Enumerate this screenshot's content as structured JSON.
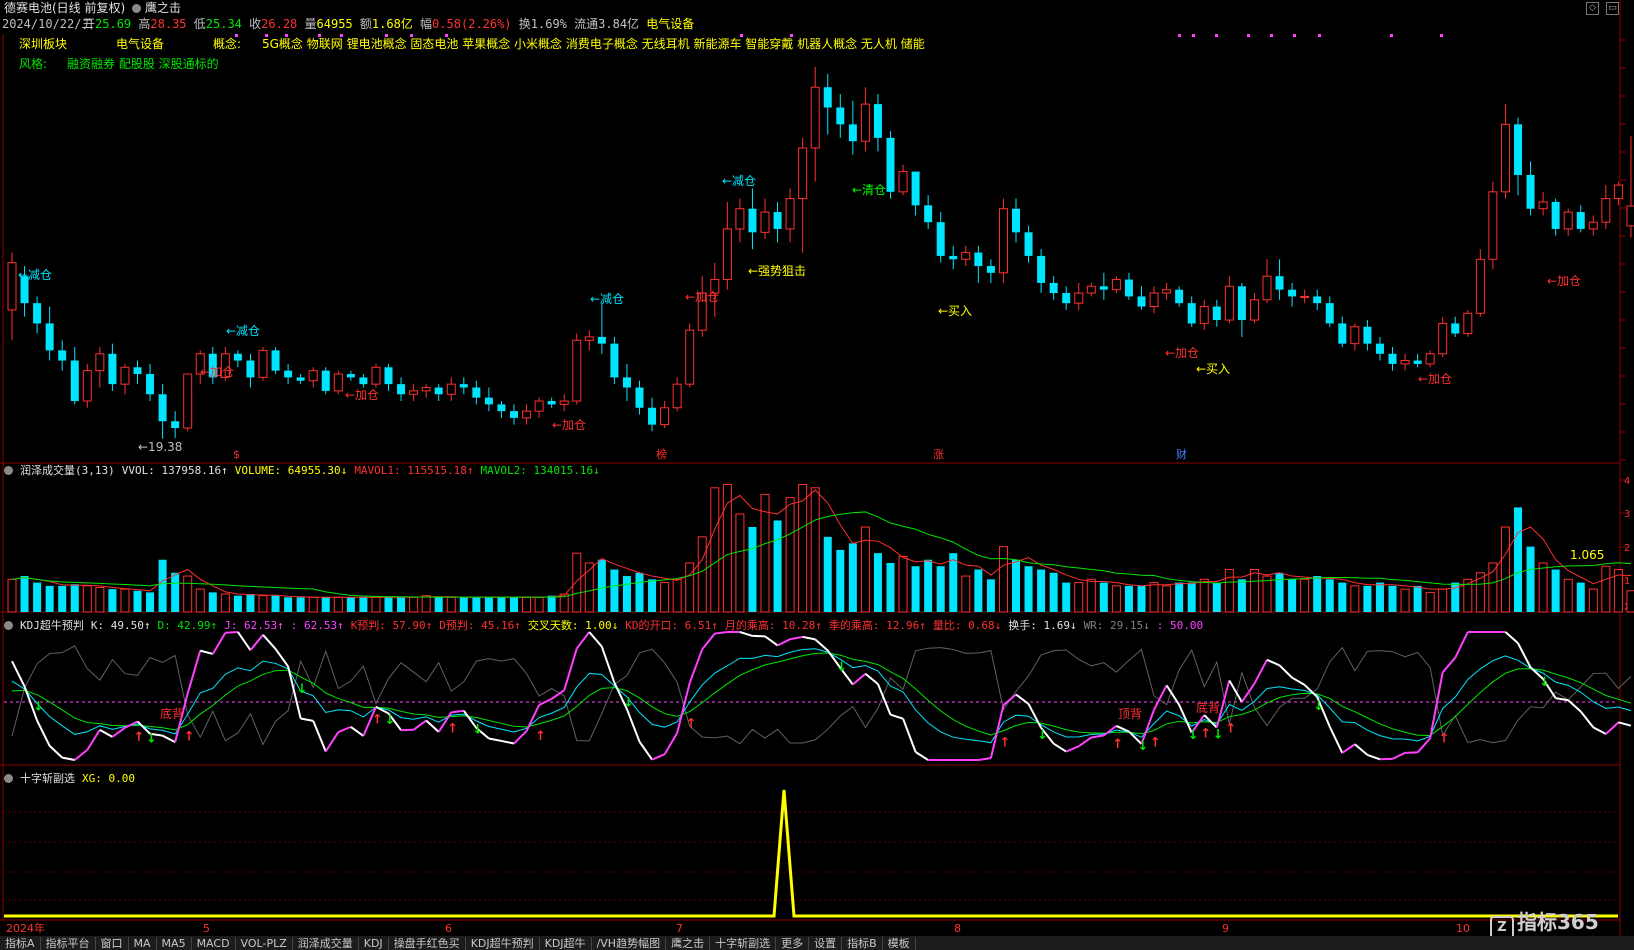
{
  "header": {
    "stock_name": "德赛电池(日线 前复权)",
    "indicator": "鹰之击",
    "date": "2024/10/22/二",
    "open_label": "开",
    "open": "25.69",
    "high_label": "高",
    "high": "28.35",
    "low_label": "低",
    "low": "25.34",
    "close_label": "收",
    "close": "26.28",
    "vol_label": "量",
    "vol": "64955",
    "amount_label": "额",
    "amount": "1.68亿",
    "change_label": "幅",
    "change": "0.58(2.26%)",
    "turnover_label": "换",
    "turnover": "1.69%",
    "float_label": "流通",
    "float": "3.84亿",
    "sector": "电气设备"
  },
  "info": {
    "board": "深圳板块",
    "industry": "电气设备",
    "concept_label": "概念:",
    "concepts": "5G概念 物联网 锂电池概念 固态电池 苹果概念 小米概念 消费电子概念 无线耳机 新能源车 智能穿戴 机器人概念 无人机 储能",
    "style_label": "风格:",
    "styles": "融资融券 配股股 深股通标的"
  },
  "annotations": [
    {
      "text": "←减仓",
      "color": "#00e5ff"
    },
    {
      "text": "←19.38",
      "color": "#c0c0c0"
    },
    {
      "text": "←减仓",
      "color": "#00e5ff"
    },
    {
      "text": "←加仓",
      "color": "#ff3030"
    },
    {
      "text": "←加仓",
      "color": "#ff3030"
    },
    {
      "text": "←加仓",
      "color": "#ff3030"
    },
    {
      "text": "←减仓",
      "color": "#00e5ff"
    },
    {
      "text": "←加仓",
      "color": "#ff3030"
    },
    {
      "text": "←减仓",
      "color": "#00e5ff"
    },
    {
      "text": "←强势狙击",
      "color": "#ffff00"
    },
    {
      "text": "←清仓",
      "color": "#00ff00"
    },
    {
      "text": "←买入",
      "color": "#ffff00"
    },
    {
      "text": "←加仓",
      "color": "#ff3030"
    },
    {
      "text": "←买入",
      "color": "#ffff00"
    },
    {
      "text": "←加仓",
      "color": "#ff3030"
    },
    {
      "text": "←加仓",
      "color": "#ff3030"
    }
  ],
  "markers": [
    {
      "text": "$",
      "color": "#ff3030"
    },
    {
      "text": "榜",
      "color": "#ff3030"
    },
    {
      "text": "涨",
      "color": "#ff3030"
    },
    {
      "text": "财",
      "color": "#4080ff"
    }
  ],
  "volume_panel": {
    "title": "润泽成交量(3,13)",
    "vvol": "VVOL: 137958.16↑",
    "volume": "VOLUME: 64955.30↓",
    "mavol1": "MAVOL1: 115515.18↑",
    "mavol2": "MAVOL2: 134015.16↓",
    "right_value": "1.065",
    "axis_labels": [
      "4",
      "3",
      "2",
      "1",
      "X1"
    ]
  },
  "kdj_panel": {
    "title": "KDJ超牛预判",
    "k": "K: 49.50↑",
    "d": "D: 42.99↑",
    "j": "J: 62.53↑",
    "j2": ": 62.53↑",
    "k_pred": "K预判: 57.90↑",
    "d_pred": "D预判: 45.16↑",
    "cross_days": "交叉天数: 1.00↓",
    "kd_gap": "KD的开口: 6.51↑",
    "month_mult": "月的乘高: 10.28↑",
    "season_mult": "季的乘高: 12.96↑",
    "vol_ratio": "量比: 0.68↓",
    "turnover": "换手: 1.69↓",
    "wr": "WR: 29.15↓",
    "val50": ": 50.00",
    "label_divergence": "底背",
    "label_divergence2": "顶背"
  },
  "xg_panel": {
    "title": "十字斩副选",
    "xg": "XG: 0.00"
  },
  "time_axis": [
    "2024年",
    "5",
    "6",
    "7",
    "8",
    "9",
    "10"
  ],
  "bottom_tabs": [
    "指标A",
    "指标平台",
    "窗口",
    "MA",
    "MA5",
    "MACD",
    "VOL-PLZ",
    "润泽成交量",
    "KDJ",
    "操盘手红色买",
    "KDJ超牛预判",
    "KDJ超牛",
    "/VH趋势幅图",
    "鹰之击",
    "十字斩副选",
    "更多",
    "设置",
    "指标B",
    "模板"
  ],
  "logo_text": "指标365",
  "chart_data": {
    "type": "candlestick",
    "candles": [
      [
        23.2,
        24.6,
        22.3,
        24.9
      ],
      [
        24.2,
        23.4,
        23.0,
        24.5
      ],
      [
        23.4,
        22.8,
        22.5,
        23.6
      ],
      [
        22.8,
        22.0,
        21.7,
        23.3
      ],
      [
        22.0,
        21.7,
        21.4,
        22.3
      ],
      [
        21.7,
        20.5,
        20.4,
        22.1
      ],
      [
        20.5,
        21.4,
        20.3,
        21.6
      ],
      [
        21.4,
        21.9,
        20.9,
        22.1
      ],
      [
        21.9,
        21.0,
        20.8,
        22.2
      ],
      [
        21.0,
        21.5,
        20.7,
        21.6
      ],
      [
        21.5,
        21.3,
        21.0,
        21.7
      ],
      [
        21.3,
        20.7,
        20.5,
        21.6
      ],
      [
        20.7,
        19.9,
        19.38,
        21.0
      ],
      [
        19.9,
        19.7,
        19.4,
        20.2
      ],
      [
        19.7,
        21.3,
        19.6,
        21.3
      ],
      [
        21.3,
        21.9,
        21.0,
        22.0
      ],
      [
        21.9,
        21.2,
        21.0,
        22.1
      ],
      [
        21.2,
        21.9,
        21.1,
        22.1
      ],
      [
        21.9,
        21.7,
        21.5,
        22.0
      ],
      [
        21.7,
        21.2,
        20.9,
        21.9
      ],
      [
        21.2,
        22.0,
        21.1,
        22.1
      ],
      [
        22.0,
        21.4,
        21.3,
        22.1
      ],
      [
        21.4,
        21.2,
        21.0,
        21.6
      ],
      [
        21.2,
        21.1,
        21.0,
        21.3
      ],
      [
        21.1,
        21.4,
        20.9,
        21.5
      ],
      [
        21.4,
        20.8,
        20.7,
        21.5
      ],
      [
        20.8,
        21.3,
        20.7,
        21.4
      ],
      [
        21.3,
        21.2,
        21.1,
        21.4
      ],
      [
        21.2,
        21.0,
        20.9,
        21.3
      ],
      [
        21.0,
        21.5,
        20.9,
        21.6
      ],
      [
        21.5,
        21.0,
        20.8,
        21.6
      ],
      [
        21.0,
        20.7,
        20.5,
        21.2
      ],
      [
        20.7,
        20.8,
        20.5,
        21.0
      ],
      [
        20.8,
        20.9,
        20.6,
        21.0
      ],
      [
        20.9,
        20.7,
        20.5,
        21.0
      ],
      [
        20.7,
        21.0,
        20.5,
        21.2
      ],
      [
        21.0,
        20.9,
        20.7,
        21.2
      ],
      [
        20.9,
        20.6,
        20.4,
        21.1
      ],
      [
        20.6,
        20.4,
        20.2,
        20.9
      ],
      [
        20.4,
        20.2,
        20.0,
        20.5
      ],
      [
        20.2,
        20.0,
        19.8,
        20.4
      ],
      [
        20.0,
        20.2,
        19.8,
        20.4
      ],
      [
        20.2,
        20.5,
        20.0,
        20.6
      ],
      [
        20.5,
        20.4,
        20.3,
        20.6
      ],
      [
        20.4,
        20.5,
        20.2,
        20.7
      ],
      [
        20.5,
        22.3,
        20.4,
        22.5
      ],
      [
        22.3,
        22.4,
        22.0,
        22.6
      ],
      [
        22.4,
        22.2,
        21.9,
        23.4
      ],
      [
        22.2,
        21.2,
        21.0,
        22.4
      ],
      [
        21.2,
        20.9,
        20.5,
        21.6
      ],
      [
        20.9,
        20.3,
        20.1,
        21.1
      ],
      [
        20.3,
        19.8,
        19.6,
        20.6
      ],
      [
        19.8,
        20.3,
        19.7,
        20.5
      ],
      [
        20.3,
        21.0,
        20.2,
        21.2
      ],
      [
        21.0,
        22.6,
        20.9,
        22.8
      ],
      [
        22.6,
        23.7,
        22.4,
        24.2
      ],
      [
        23.7,
        24.1,
        23.0,
        24.6
      ],
      [
        24.1,
        25.6,
        23.8,
        26.4
      ],
      [
        25.6,
        26.2,
        25.2,
        26.5
      ],
      [
        26.2,
        25.5,
        25.0,
        26.8
      ],
      [
        25.5,
        26.1,
        25.3,
        26.5
      ],
      [
        26.1,
        25.6,
        25.2,
        26.4
      ],
      [
        25.6,
        26.5,
        25.2,
        26.8
      ],
      [
        26.5,
        28.0,
        24.9,
        28.3
      ],
      [
        28.0,
        29.8,
        27.0,
        30.4
      ],
      [
        29.8,
        29.2,
        28.4,
        30.2
      ],
      [
        29.2,
        28.7,
        28.3,
        29.6
      ],
      [
        28.7,
        28.2,
        27.8,
        29.4
      ],
      [
        28.2,
        29.3,
        27.9,
        29.8
      ],
      [
        29.3,
        28.3,
        27.9,
        29.6
      ],
      [
        28.3,
        26.7,
        26.5,
        28.5
      ],
      [
        26.7,
        27.3,
        26.6,
        27.5
      ],
      [
        27.3,
        26.3,
        26.0,
        27.3
      ],
      [
        26.3,
        25.8,
        25.6,
        26.6
      ],
      [
        25.8,
        24.8,
        24.6,
        26.1
      ],
      [
        24.8,
        24.7,
        24.4,
        25.1
      ],
      [
        24.7,
        24.9,
        24.5,
        25.1
      ],
      [
        24.9,
        24.5,
        24.0,
        25.1
      ],
      [
        24.5,
        24.3,
        24.0,
        24.7
      ],
      [
        24.3,
        26.2,
        24.0,
        26.5
      ],
      [
        26.2,
        25.5,
        25.2,
        26.5
      ],
      [
        25.5,
        24.8,
        24.6,
        25.7
      ],
      [
        24.8,
        24.0,
        23.7,
        25.0
      ],
      [
        24.0,
        23.7,
        23.5,
        24.2
      ],
      [
        23.7,
        23.4,
        23.2,
        23.9
      ],
      [
        23.4,
        23.7,
        23.2,
        24.0
      ],
      [
        23.7,
        23.9,
        23.6,
        24.0
      ],
      [
        23.9,
        23.8,
        23.5,
        24.3
      ],
      [
        23.8,
        24.1,
        23.7,
        24.2
      ],
      [
        24.1,
        23.6,
        23.5,
        24.3
      ],
      [
        23.6,
        23.3,
        23.2,
        23.9
      ],
      [
        23.3,
        23.7,
        23.1,
        23.9
      ],
      [
        23.7,
        23.8,
        23.5,
        24.0
      ],
      [
        23.8,
        23.4,
        23.3,
        23.9
      ],
      [
        23.4,
        22.8,
        22.7,
        23.6
      ],
      [
        22.8,
        23.3,
        22.6,
        23.5
      ],
      [
        23.3,
        22.9,
        22.7,
        23.5
      ],
      [
        22.9,
        23.9,
        22.8,
        24.2
      ],
      [
        23.9,
        22.9,
        22.4,
        24.0
      ],
      [
        22.9,
        23.5,
        22.8,
        23.7
      ],
      [
        23.5,
        24.2,
        23.4,
        24.7
      ],
      [
        24.2,
        23.8,
        23.5,
        24.7
      ],
      [
        23.8,
        23.6,
        23.3,
        24.0
      ],
      [
        23.6,
        23.6,
        23.4,
        23.8
      ],
      [
        23.6,
        23.4,
        23.2,
        23.8
      ],
      [
        23.4,
        22.8,
        22.7,
        23.6
      ],
      [
        22.8,
        22.2,
        22.1,
        23.0
      ],
      [
        22.2,
        22.7,
        22.0,
        22.8
      ],
      [
        22.7,
        22.2,
        22.0,
        22.9
      ],
      [
        22.2,
        21.9,
        21.7,
        22.4
      ],
      [
        21.9,
        21.6,
        21.4,
        22.1
      ],
      [
        21.6,
        21.7,
        21.4,
        21.9
      ],
      [
        21.7,
        21.6,
        21.5,
        21.9
      ],
      [
        21.6,
        21.9,
        21.5,
        22.0
      ],
      [
        21.9,
        22.8,
        21.8,
        23.0
      ],
      [
        22.8,
        22.5,
        22.4,
        23.0
      ],
      [
        22.5,
        23.1,
        22.4,
        23.2
      ],
      [
        23.1,
        24.7,
        23.0,
        25.0
      ],
      [
        24.7,
        26.7,
        24.4,
        27.0
      ],
      [
        26.7,
        28.7,
        26.5,
        29.3
      ],
      [
        28.7,
        27.2,
        26.6,
        28.9
      ],
      [
        27.2,
        26.2,
        26.0,
        27.6
      ],
      [
        26.2,
        26.4,
        26.0,
        26.7
      ],
      [
        26.4,
        25.6,
        25.4,
        26.5
      ],
      [
        25.6,
        26.1,
        25.4,
        26.2
      ],
      [
        26.1,
        25.6,
        25.5,
        26.3
      ],
      [
        25.6,
        25.8,
        25.4,
        26.0
      ],
      [
        25.8,
        26.5,
        25.6,
        26.9
      ],
      [
        26.5,
        26.9,
        26.3,
        27.0
      ],
      [
        25.69,
        26.28,
        25.34,
        28.35
      ]
    ],
    "volume": [
      1.0,
      1.1,
      0.9,
      0.8,
      0.8,
      0.85,
      0.8,
      0.75,
      0.7,
      0.7,
      0.65,
      0.6,
      1.6,
      1.2,
      1.1,
      0.7,
      0.6,
      0.55,
      0.5,
      0.55,
      0.5,
      0.5,
      0.45,
      0.45,
      0.45,
      0.45,
      0.45,
      0.45,
      0.45,
      0.45,
      0.45,
      0.45,
      0.45,
      0.5,
      0.45,
      0.45,
      0.45,
      0.45,
      0.45,
      0.45,
      0.45,
      0.45,
      0.45,
      0.5,
      0.55,
      1.8,
      1.5,
      1.6,
      1.3,
      1.1,
      1.2,
      1.0,
      0.9,
      1.0,
      1.5,
      2.3,
      3.8,
      3.9,
      3.0,
      2.6,
      3.6,
      2.8,
      3.5,
      3.9,
      3.8,
      2.3,
      1.9,
      2.1,
      2.6,
      1.8,
      1.5,
      1.7,
      1.4,
      1.6,
      1.4,
      1.8,
      1.1,
      1.3,
      1.0,
      2.0,
      1.6,
      1.4,
      1.3,
      1.2,
      0.9,
      0.9,
      1.0,
      0.9,
      0.8,
      0.8,
      0.8,
      0.9,
      0.8,
      0.9,
      0.9,
      1.0,
      0.9,
      1.3,
      1.0,
      1.3,
      1.1,
      1.2,
      1.0,
      1.0,
      1.1,
      1.0,
      0.9,
      0.8,
      0.8,
      0.9,
      0.8,
      0.7,
      0.8,
      0.6,
      0.7,
      0.9,
      1.0,
      1.2,
      1.5,
      2.6,
      3.2,
      2.0,
      1.5,
      1.3,
      1.0,
      0.9,
      0.7,
      1.4,
      1.3,
      0.65
    ]
  }
}
